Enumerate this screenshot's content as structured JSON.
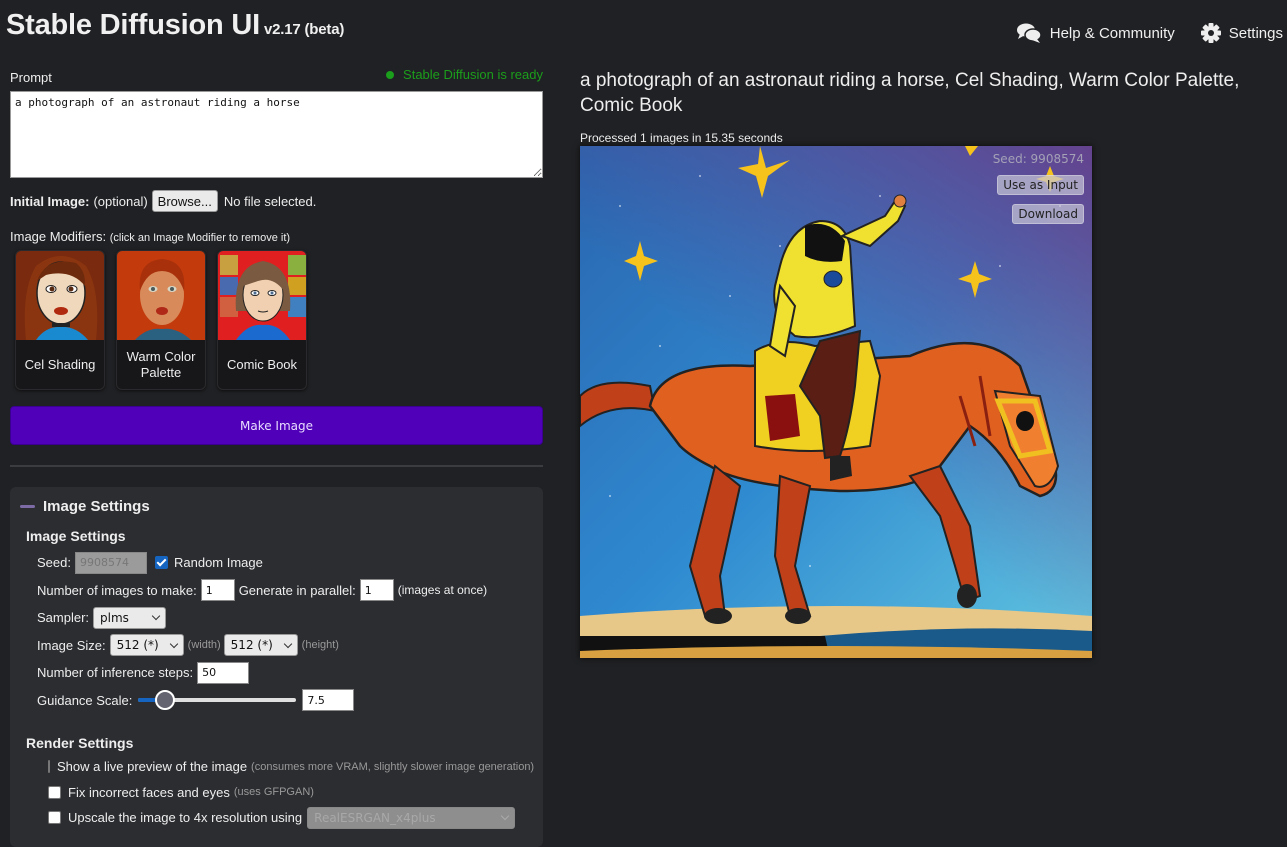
{
  "header": {
    "title": "Stable Diffusion UI",
    "version": "v2.17 (beta)",
    "nav": [
      {
        "label": "Help & Community",
        "icon": "chat-bubbles-icon"
      },
      {
        "label": "Settings",
        "icon": "gear-icon"
      }
    ]
  },
  "prompt": {
    "label": "Prompt",
    "status": "Stable Diffusion is ready",
    "status_color": "#1b9e1b",
    "value": "a photograph of an astronaut riding a horse"
  },
  "initial_image": {
    "label": "Initial Image:",
    "optional": "(optional)",
    "browse_label": "Browse...",
    "file_status": "No file selected."
  },
  "modifiers": {
    "title": "Image Modifiers:",
    "hint": "(click an Image Modifier to remove it)",
    "items": [
      {
        "label": "Cel Shading"
      },
      {
        "label": "Warm Color Palette"
      },
      {
        "label": "Comic Book"
      }
    ]
  },
  "make_button": {
    "label": "Make Image",
    "color": "#5000b9"
  },
  "settings": {
    "panel_title": "Image Settings",
    "section_title": "Image Settings",
    "seed_label": "Seed:",
    "seed_value": "9908574",
    "random_label": "Random Image",
    "random_checked": true,
    "num_images_label": "Number of images to make:",
    "num_images_value": "1",
    "parallel_label": "Generate in parallel:",
    "parallel_value": "1",
    "parallel_hint": "(images at once)",
    "sampler_label": "Sampler:",
    "sampler_value": "plms",
    "size_label": "Image Size:",
    "width_value": "512 (*)",
    "width_hint": "(width)",
    "height_value": "512 (*)",
    "height_hint": "(height)",
    "steps_label": "Number of inference steps:",
    "steps_value": "50",
    "guidance_label": "Guidance Scale:",
    "guidance_value": "7.5",
    "guidance_slider_fraction": 0.17
  },
  "render": {
    "title": "Render Settings",
    "options": [
      {
        "label": "Show a live preview of the image",
        "hint": "(consumes more VRAM, slightly slower image generation)",
        "checked": false
      },
      {
        "label": "Fix incorrect faces and eyes",
        "hint": "(uses GFPGAN)",
        "checked": false
      },
      {
        "label": "Upscale the image to 4x resolution using",
        "hint": "",
        "checked": false
      }
    ],
    "upscaler_value": "RealESRGAN_x4plus"
  },
  "result": {
    "title": "a photograph of an astronaut riding a horse, Cel Shading, Warm Color Palette, Comic Book",
    "processed": "Processed 1 images in 15.35 seconds",
    "seed_label": "Seed: 9908574",
    "use_as_input_label": "Use as Input",
    "download_label": "Download"
  }
}
